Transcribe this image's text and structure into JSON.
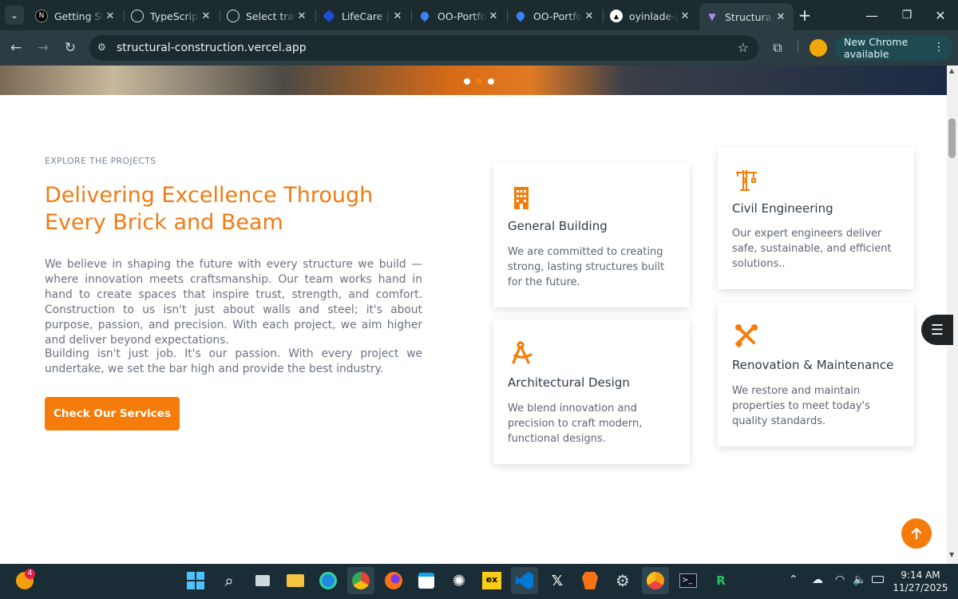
{
  "browser": {
    "tabs": [
      {
        "title": "Getting Started",
        "icon": "nextjs-icon",
        "color": "#000000",
        "glyph": "N"
      },
      {
        "title": "TypeScript",
        "icon": "openai-icon",
        "color": "#1b2b30",
        "glyph": "⚙"
      },
      {
        "title": "Select track",
        "icon": "globe-icon",
        "color": "#1b2b30",
        "glyph": "◍"
      },
      {
        "title": "LifeCare | Home",
        "icon": "lifecare-icon",
        "color": "#2563eb",
        "glyph": "◆"
      },
      {
        "title": "OO-Portfolio",
        "icon": "droplet-icon",
        "color": "#1b2b30",
        "glyph": "💧"
      },
      {
        "title": "OO-Portfolio",
        "icon": "droplet-icon",
        "color": "#1b2b30",
        "glyph": "💧"
      },
      {
        "title": "oyinlade-portfolio",
        "icon": "vercel-icon",
        "color": "#000000",
        "glyph": "▲"
      },
      {
        "title": "Structura_Construction",
        "icon": "vite-icon",
        "color": "#6d28d9",
        "glyph": "▼"
      }
    ],
    "new_tab": "+",
    "url": "structural-construction.vercel.app",
    "new_chrome": "New Chrome available"
  },
  "page": {
    "kicker": "EXPLORE THE PROJECTS",
    "heading": "Delivering Excellence Through Every Brick and Beam",
    "paragraph1": "We believe in shaping the future with every structure we build — where innovation meets craftsmanship. Our team works hand in hand to create spaces that inspire trust, strength, and comfort. Construction to us isn't just about walls and steel; it's about purpose, passion, and precision. With each project, we aim higher and deliver beyond expectations.",
    "paragraph2": "Building isn't just job. It's our passion. With every project we undertake, we set the bar high and provide the best industry.",
    "cta": "Check Our Services",
    "accent": "#f57c0a",
    "cards": [
      {
        "title": "General Building",
        "desc": "We are committed to creating strong, lasting structures built for the future.",
        "icon": "building-icon"
      },
      {
        "title": "Civil Engineering",
        "desc": "Our expert engineers deliver safe, sustainable, and efficient solutions..",
        "icon": "crane-icon"
      },
      {
        "title": "Architectural Design",
        "desc": "We blend innovation and precision to craft modern, functional designs.",
        "icon": "compass-icon"
      },
      {
        "title": "Renovation & Maintenance",
        "desc": "We restore and maintain properties to meet today's quality standards.",
        "icon": "tools-icon"
      }
    ]
  },
  "taskbar": {
    "notification_badge": "4",
    "time": "9:14 AM",
    "date": "11/27/2025"
  }
}
